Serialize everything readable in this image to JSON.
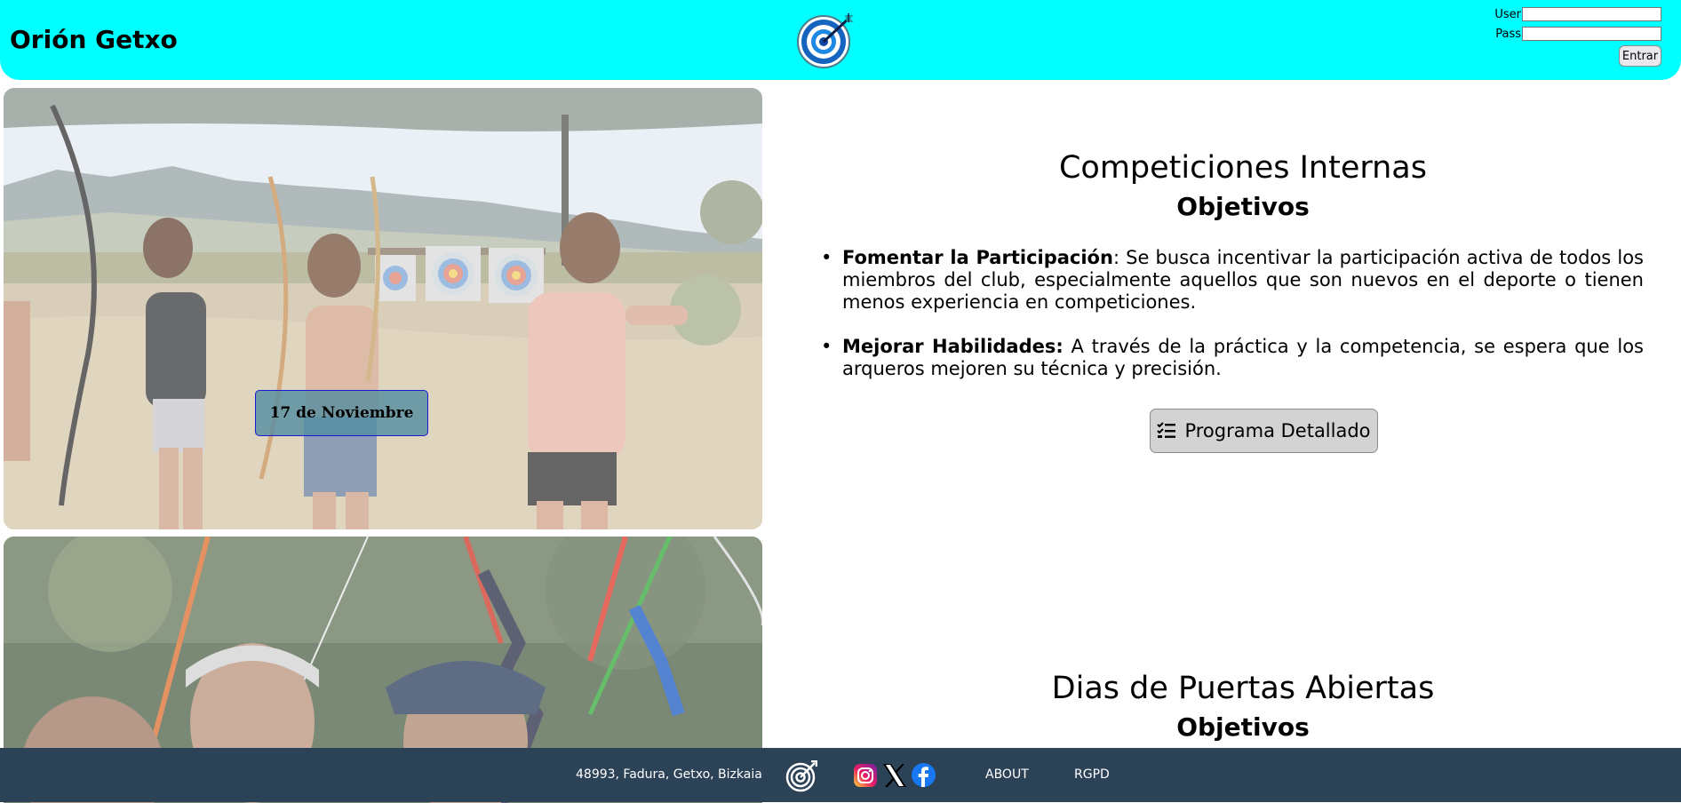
{
  "header": {
    "brand": "Orión Getxo",
    "logo_icon": "archery-target-icon",
    "login": {
      "user_label": "User",
      "pass_label": "Pass",
      "submit_label": "Entrar"
    }
  },
  "cards": [
    {
      "badge": "17 de Noviembre",
      "image": "girls-archery-practice-photo"
    },
    {
      "image": "archers-drawing-bows-photo"
    }
  ],
  "sections": [
    {
      "title": "Competiciones Internas",
      "subtitle": "Objetivos",
      "items": [
        {
          "bold": "Fomentar la Participación",
          "text": ": Se busca incentivar la participación activa de todos los miembros del club, especialmente aquellos que son nuevos en el deporte o tienen menos experiencia en competiciones."
        },
        {
          "bold": "Mejorar Habilidades:",
          "text": " A través de la práctica y la competencia, se espera que los arqueros mejoren su técnica y precisión."
        }
      ],
      "button": "Programa Detallado",
      "button_icon": "checklist-icon"
    },
    {
      "title": "Dias de Puertas Abiertas",
      "subtitle": "Objetivos"
    }
  ],
  "footer": {
    "address": "48993, Fadura, Getxo, Bizkaia",
    "about": "ABOUT",
    "rgpd": "RGPD",
    "icons": [
      "target-logo-icon",
      "instagram-icon",
      "x-icon",
      "facebook-icon"
    ]
  },
  "colors": {
    "header_bg": "#00ffff",
    "footer_bg": "#2c4257",
    "button_bg": "#d3d3d3"
  }
}
